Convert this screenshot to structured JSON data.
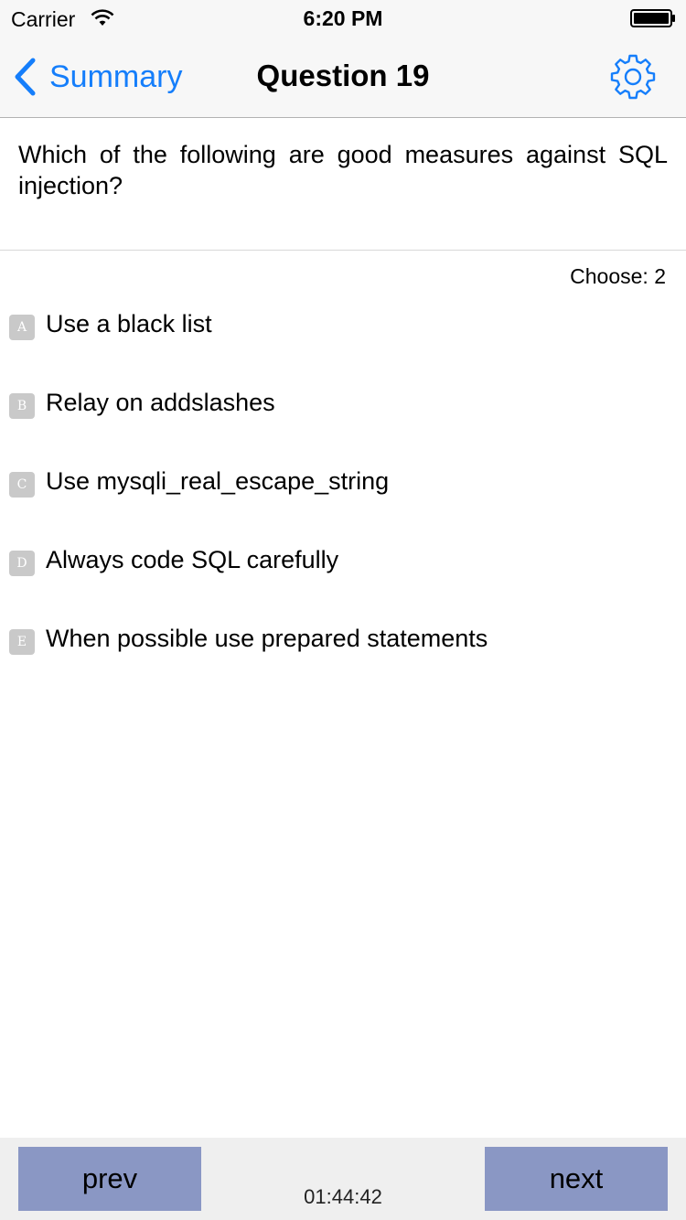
{
  "status_bar": {
    "carrier": "Carrier",
    "time": "6:20 PM"
  },
  "nav": {
    "back_label": "Summary",
    "title": "Question 19",
    "settings_icon": "gear-icon",
    "accent_color": "#157efb"
  },
  "question": {
    "text": "Which of the following are good measures against SQL injection?",
    "choose_label": "Choose: 2"
  },
  "options": [
    {
      "letter": "A",
      "text": "Use a black list"
    },
    {
      "letter": "B",
      "text": "Relay on addslashes"
    },
    {
      "letter": "C",
      "text": "Use mysqli_real_escape_string"
    },
    {
      "letter": "D",
      "text": "Always code SQL carefully"
    },
    {
      "letter": "E",
      "text": "When possible use prepared statements"
    }
  ],
  "footer": {
    "prev_label": "prev",
    "next_label": "next",
    "timer": "01:44:42",
    "button_color": "#8a97c4"
  }
}
